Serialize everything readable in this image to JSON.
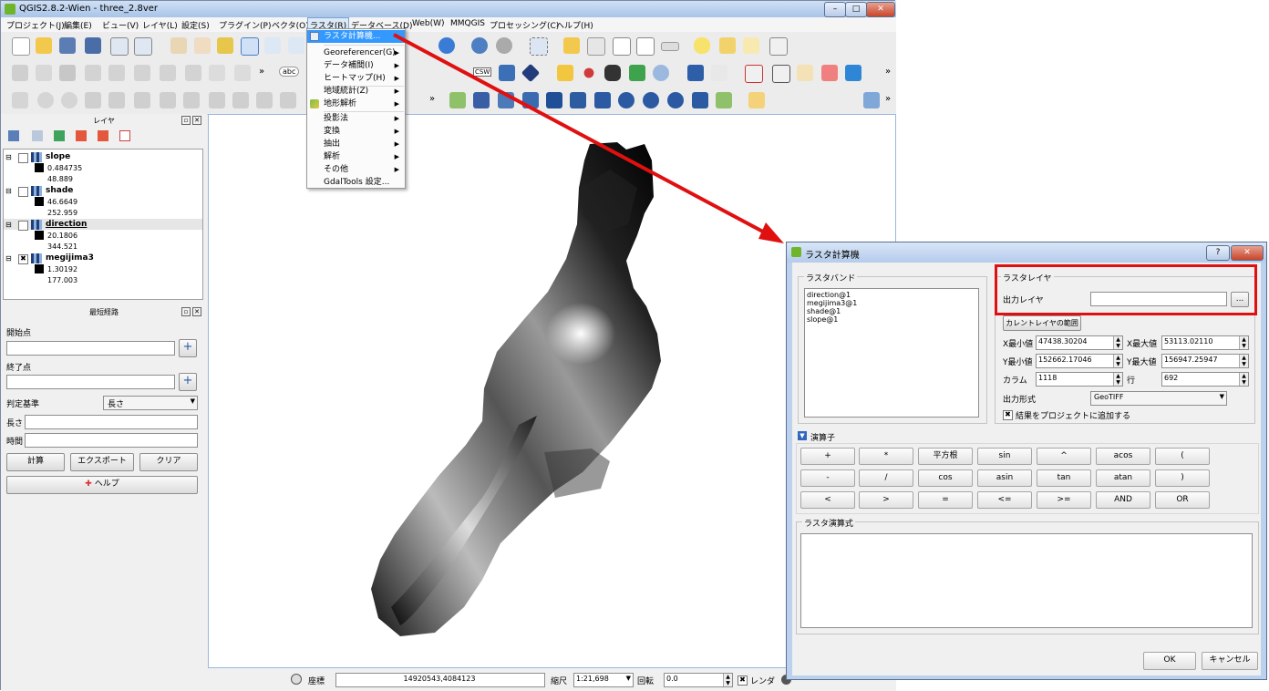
{
  "window": {
    "title": "QGIS2.8.2-Wien - three_2.8ver",
    "min": "–",
    "max": "□",
    "close": "✕"
  },
  "menubar": [
    "プロジェクト(J)",
    "編集(E)",
    "ビュー(V)",
    "レイヤ(L)",
    "設定(S)",
    "プラグイン(P)",
    "ベクタ(O)",
    "ラスタ(R)",
    "データベース(D)",
    "Web(W)",
    "MMQGIS",
    "プロセッシング(C)",
    "ヘルプ(H)"
  ],
  "raster_menu": {
    "items": [
      {
        "label": "ラスタ計算機...",
        "submenu": false,
        "selected": true
      },
      {
        "label": "Georeferencer(G)",
        "submenu": true
      },
      {
        "label": "データ補間(I)",
        "submenu": true
      },
      {
        "label": "ヒートマップ(H)",
        "submenu": true
      },
      {
        "label": "地域統計(Z)",
        "submenu": true
      },
      {
        "label": "地形解析",
        "submenu": true
      },
      {
        "label": "投影法",
        "submenu": true
      },
      {
        "label": "変換",
        "submenu": true
      },
      {
        "label": "抽出",
        "submenu": true
      },
      {
        "label": "解析",
        "submenu": true
      },
      {
        "label": "その他",
        "submenu": true
      },
      {
        "label": "GdalTools 設定...",
        "submenu": false
      }
    ]
  },
  "toolbar": {
    "overflow": "»",
    "abc": "abc",
    "csw": "CSW"
  },
  "layers_panel": {
    "title": "レイヤ",
    "layers": [
      {
        "name": "slope",
        "min": "0.484735",
        "max": "48.889",
        "checked": false
      },
      {
        "name": "shade",
        "min": "46.6649",
        "max": "252.959",
        "checked": false
      },
      {
        "name": "direction",
        "min": "20.1806",
        "max": "344.521",
        "checked": false
      },
      {
        "name": "megijima3",
        "min": "1.30192",
        "max": "177.003",
        "checked": true
      }
    ]
  },
  "route_panel": {
    "title": "最短経路",
    "start_label": "開始点",
    "end_label": "終了点",
    "criterion_label": "判定基準",
    "criterion_value": "長さ",
    "length_label": "長さ",
    "time_label": "時間",
    "calc_button": "計算",
    "export_button": "エクスポート",
    "clear_button": "クリア",
    "help_button": "ヘルプ"
  },
  "statusbar": {
    "coord_label": "座標",
    "coord_value": "14920543,4084123",
    "scale_label": "縮尺",
    "scale_value": "1:21,698",
    "rotation_label": "回転",
    "rotation_value": "0.0",
    "render_label": "レンダ"
  },
  "dialog": {
    "title": "ラスタ計算機",
    "help": "?",
    "close": "✕",
    "bands_title": "ラスタバンド",
    "bands": [
      "direction@1",
      "megijima3@1",
      "shade@1",
      "slope@1"
    ],
    "result_title": "ラスタレイヤ",
    "output_layer_label": "出力レイヤ",
    "output_layer_value": "",
    "browse": "...",
    "current_extent_button": "カレントレイヤの範囲",
    "xmin_label": "X最小値",
    "xmin_value": "47438.30204",
    "xmax_label": "X最大値",
    "xmax_value": "53113.02110",
    "ymin_label": "Y最小値",
    "ymin_value": "152662.17046",
    "ymax_label": "Y最大値",
    "ymax_value": "156947.25947",
    "columns_label": "カラム",
    "columns_value": "1118",
    "rows_label": "行",
    "rows_value": "692",
    "format_label": "出力形式",
    "format_value": "GeoTIFF",
    "add_to_project_label": "結果をプロジェクトに追加する",
    "operators_title": "演算子",
    "operators": [
      [
        "+",
        "*",
        "平方根",
        "sin",
        "^",
        "acos",
        "("
      ],
      [
        "-",
        "/",
        "cos",
        "asin",
        "tan",
        "atan",
        ")"
      ],
      [
        "<",
        ">",
        "=",
        "<=",
        ">=",
        "AND",
        "OR"
      ]
    ],
    "expression_title": "ラスタ演算式",
    "ok": "OK",
    "cancel": "キャンセル"
  },
  "colors": {
    "highlight": "#e01010",
    "menu_selected": "#3399ff"
  }
}
